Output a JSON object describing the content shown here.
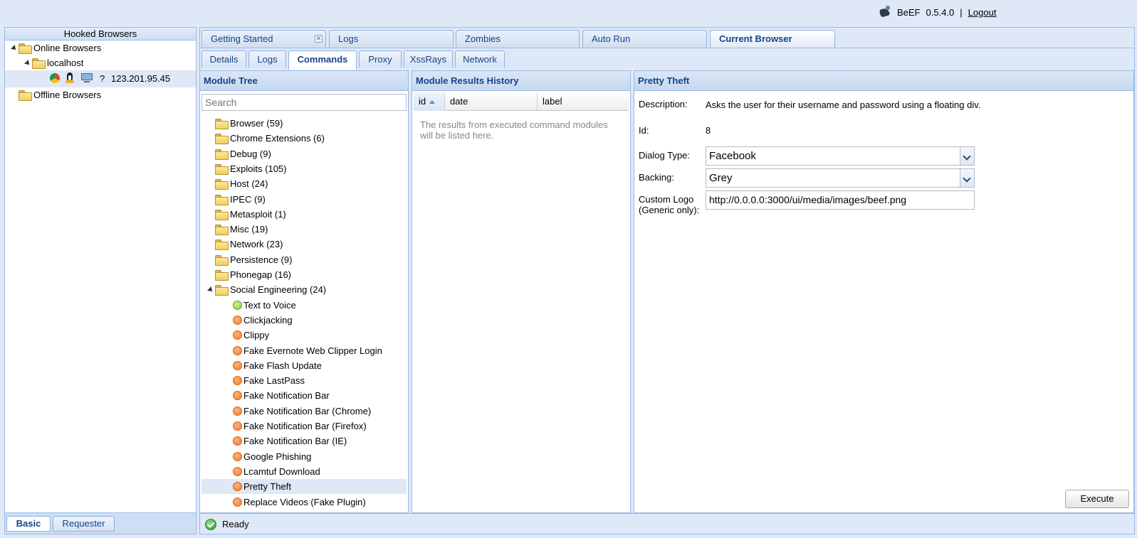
{
  "header": {
    "app_name": "BeEF",
    "version": "0.5.4.0",
    "separator": "|",
    "logout_label": "Logout"
  },
  "hooked_browsers": {
    "title": "Hooked Browsers",
    "online_label": "Online Browsers",
    "host_label": "localhost",
    "browser_ip": "123.201.95.45",
    "browser_icons": [
      "chrome-icon",
      "linux-icon",
      "computer-icon",
      "unknown-icon"
    ],
    "offline_label": "Offline Browsers",
    "tabs": [
      "Basic",
      "Requester"
    ]
  },
  "main_tabs": [
    {
      "label": "Getting Started",
      "closable": true
    },
    {
      "label": "Logs"
    },
    {
      "label": "Zombies"
    },
    {
      "label": "Auto Run"
    },
    {
      "label": "Current Browser",
      "active": true
    }
  ],
  "sub_tabs": [
    {
      "label": "Details"
    },
    {
      "label": "Logs"
    },
    {
      "label": "Commands",
      "active": true
    },
    {
      "label": "Proxy"
    },
    {
      "label": "XssRays"
    },
    {
      "label": "Network"
    }
  ],
  "module_tree": {
    "title": "Module Tree",
    "search_placeholder": "Search",
    "categories": [
      "Browser (59)",
      "Chrome Extensions (6)",
      "Debug (9)",
      "Exploits (105)",
      "Host (24)",
      "IPEC (9)",
      "Metasploit (1)",
      "Misc (19)",
      "Network (23)",
      "Persistence (9)",
      "Phonegap (16)"
    ],
    "expanded_category": "Social Engineering (24)",
    "modules": [
      {
        "label": "Text to Voice",
        "status": "green"
      },
      {
        "label": "Clickjacking",
        "status": "orange"
      },
      {
        "label": "Clippy",
        "status": "orange"
      },
      {
        "label": "Fake Evernote Web Clipper Login",
        "status": "orange"
      },
      {
        "label": "Fake Flash Update",
        "status": "orange"
      },
      {
        "label": "Fake LastPass",
        "status": "orange"
      },
      {
        "label": "Fake Notification Bar",
        "status": "orange"
      },
      {
        "label": "Fake Notification Bar (Chrome)",
        "status": "orange"
      },
      {
        "label": "Fake Notification Bar (Firefox)",
        "status": "orange"
      },
      {
        "label": "Fake Notification Bar (IE)",
        "status": "orange"
      },
      {
        "label": "Google Phishing",
        "status": "orange"
      },
      {
        "label": "Lcamtuf Download",
        "status": "orange"
      },
      {
        "label": "Pretty Theft",
        "status": "orange",
        "selected": true
      },
      {
        "label": "Replace Videos (Fake Plugin)",
        "status": "orange"
      }
    ]
  },
  "results_history": {
    "title": "Module Results History",
    "columns": [
      "id",
      "date",
      "label"
    ],
    "empty_text": "The results from executed command modules will be listed here."
  },
  "module_detail": {
    "title": "Pretty Theft",
    "description_label": "Description:",
    "description": "Asks the user for their username and password using a floating div.",
    "id_label": "Id:",
    "id_value": "8",
    "dialog_type_label": "Dialog Type:",
    "dialog_type_value": "Facebook",
    "backing_label": "Backing:",
    "backing_value": "Grey",
    "custom_logo_label_1": "Custom Logo",
    "custom_logo_label_2": "(Generic only):",
    "custom_logo_value": "http://0.0.0.0:3000/ui/media/images/beef.png",
    "execute_label": "Execute"
  },
  "status": {
    "text": "Ready"
  },
  "colors": {
    "background": "#dfe8f6",
    "panel_border": "#99bbe8",
    "header_text": "#15428b",
    "status_orange": "#f27a2a",
    "status_green": "#8cc63f"
  }
}
